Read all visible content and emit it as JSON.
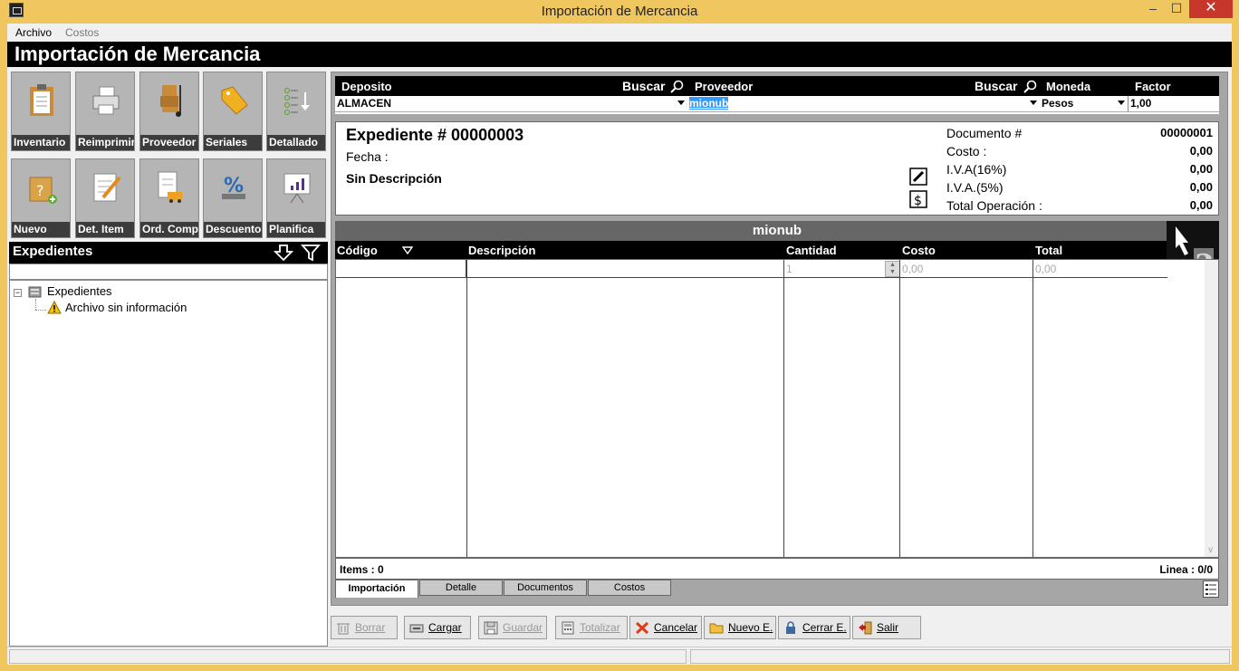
{
  "window": {
    "title": "Importación de Mercancia",
    "min": "–",
    "max": "☐",
    "close": "✕"
  },
  "menu": {
    "archivo": "Archivo",
    "costos": "Costos"
  },
  "banner": {
    "title": "Importación de Mercancia"
  },
  "toolbar": {
    "inventario": "Inventario",
    "reimprimir": "Reimprimir",
    "proveedor": "Proveedor",
    "seriales": "Seriales",
    "detallado": "Detallado",
    "nuevo": "Nuevo",
    "det_item": "Det. Item",
    "ord_comp": "Ord. Comp.",
    "descuento": "Descuento",
    "planifica": "Planifica"
  },
  "expedientes": {
    "header": "Expedientes",
    "root": "Expedientes",
    "child": "Archivo sin información"
  },
  "header": {
    "deposito_label": "Deposito",
    "buscar1": "Buscar",
    "proveedor_label": "Proveedor",
    "buscar2": "Buscar",
    "moneda_label": "Moneda",
    "factor_label": "Factor",
    "deposito_value": "ALMACEN",
    "proveedor_value": "mionub",
    "moneda_value": "Pesos",
    "factor_value": "1,00"
  },
  "info": {
    "expediente": "Expediente # 00000003",
    "fecha_label": "Fecha :",
    "descripcion": "Sin Descripción",
    "documento_label": "Documento #",
    "documento_value": "00000001",
    "costo_label": "Costo :",
    "costo_value": "0,00",
    "iva16_label": "I.V.A(16%)",
    "iva16_value": "0,00",
    "iva5_label": "I.V.A.(5%)",
    "iva5_value": "0,00",
    "total_label": "Total Operación :",
    "total_value": "0,00"
  },
  "grid": {
    "title": "mionub",
    "columns": [
      "Código",
      "Descripción",
      "Cantidad",
      "Costo",
      "Total"
    ],
    "row": {
      "cantidad": "1",
      "costo": "0,00",
      "total": "0,00"
    }
  },
  "status": {
    "items": "Items : 0",
    "linea": "Linea : 0/0"
  },
  "tabs": [
    "Importación",
    "Detalle",
    "Documentos",
    "Costos"
  ],
  "buttons": {
    "borrar": "Borrar",
    "cargar": "Cargar",
    "guardar": "Guardar",
    "totalizar": "Totalizar",
    "cancelar": "Cancelar",
    "nuevo_e": "Nuevo E.",
    "cerrar_e": "Cerrar E.",
    "salir": "Salir"
  },
  "colors": {
    "accent": "#f0c75e",
    "close": "#c7362b",
    "selection": "#3399ff"
  }
}
